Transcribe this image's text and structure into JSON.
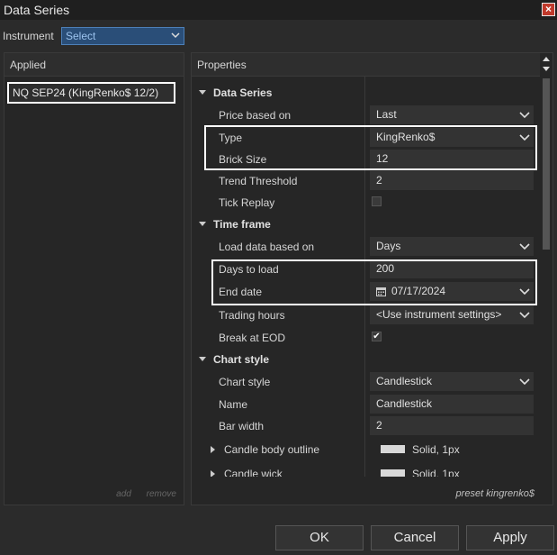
{
  "window": {
    "title": "Data Series"
  },
  "instrument": {
    "label": "Instrument",
    "value": "Select"
  },
  "applied": {
    "header": "Applied",
    "item": "NQ SEP24 (KingRenko$ 12/2)",
    "add_label": "add",
    "remove_label": "remove"
  },
  "properties": {
    "header": "Properties",
    "sections": {
      "data_series": {
        "title": "Data Series",
        "price_based_on": {
          "label": "Price based on",
          "value": "Last"
        },
        "type": {
          "label": "Type",
          "value": "KingRenko$"
        },
        "brick_size": {
          "label": "Brick Size",
          "value": "12"
        },
        "trend_threshold": {
          "label": "Trend Threshold",
          "value": "2"
        },
        "tick_replay": {
          "label": "Tick Replay",
          "checked": false
        }
      },
      "time_frame": {
        "title": "Time frame",
        "load_data_based_on": {
          "label": "Load data based on",
          "value": "Days"
        },
        "days_to_load": {
          "label": "Days to load",
          "value": "200"
        },
        "end_date": {
          "label": "End date",
          "value": "07/17/2024"
        },
        "trading_hours": {
          "label": "Trading hours",
          "value": "<Use instrument settings>"
        },
        "break_at_eod": {
          "label": "Break at EOD",
          "checked": true,
          "check_glyph": "✔"
        }
      },
      "chart_style": {
        "title": "Chart style",
        "chart_style": {
          "label": "Chart style",
          "value": "Candlestick"
        },
        "name": {
          "label": "Name",
          "value": "Candlestick"
        },
        "bar_width": {
          "label": "Bar width",
          "value": "2"
        },
        "candle_body_outline": {
          "label": "Candle body outline",
          "value": "Solid, 1px"
        },
        "candle_wick": {
          "label": "Candle wick",
          "value": "Solid, 1px"
        }
      }
    },
    "preset": "preset kingrenko$"
  },
  "buttons": {
    "ok": "OK",
    "cancel": "Cancel",
    "apply": "Apply"
  },
  "colors": {
    "highlight": "#ffffff",
    "accent": "#2a4e78",
    "close": "#c0392b"
  }
}
